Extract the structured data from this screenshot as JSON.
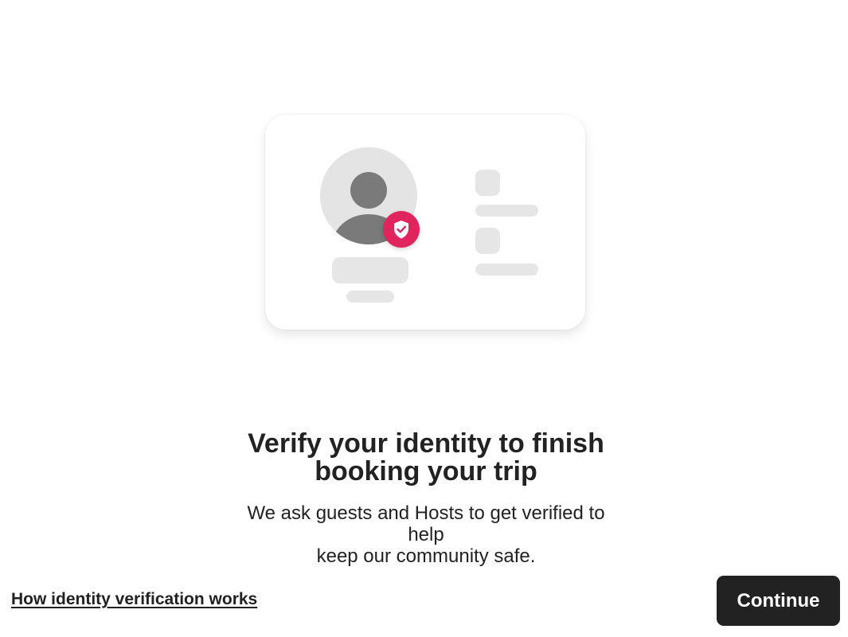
{
  "illustration": {
    "icon": "id-card-verified-icon",
    "badge_icon": "shield-check-icon",
    "badge_color": "#e0245e",
    "placeholder_color": "#e6e6e6",
    "avatar_color": "#7a7a7a"
  },
  "content": {
    "title_line1": "Verify your identity to finish",
    "title_line2": "booking your trip",
    "subtitle_line1": "We ask guests and Hosts to get verified to help",
    "subtitle_line2": "keep our community safe."
  },
  "footer": {
    "help_link_label": "How identity verification works",
    "continue_label": "Continue",
    "continue_color": "#222222"
  }
}
